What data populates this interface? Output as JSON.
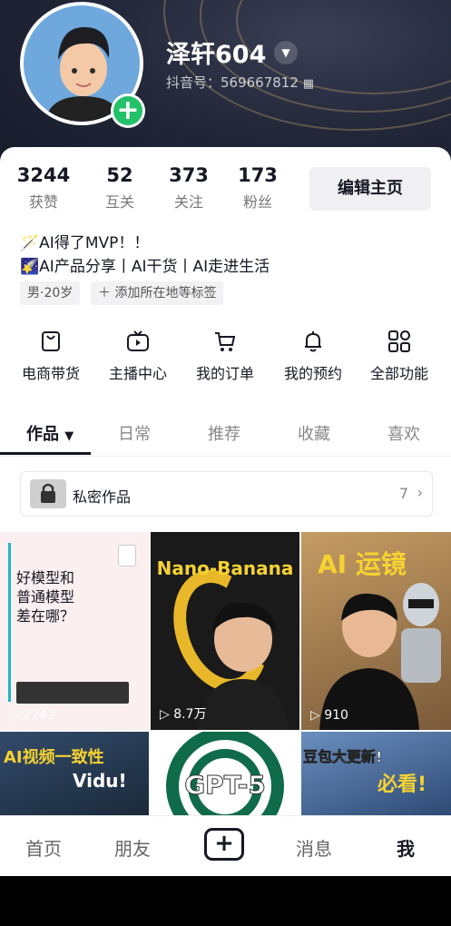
{
  "profile": {
    "username": "泽轩604",
    "douyin_id": "抖音号：569667812",
    "stats": [
      {
        "value": "3244",
        "label": "获赞"
      },
      {
        "value": "52",
        "label": "互关"
      },
      {
        "value": "373",
        "label": "关注"
      },
      {
        "value": "173",
        "label": "粉丝"
      }
    ],
    "edit_label": "编辑主页",
    "bio_line1": "AI得了MVP！！",
    "bio_line2": "AI产品分享丨AI干货丨AI走进生活",
    "tags": [
      "男·20岁",
      "＋ 添加所在地等标签"
    ]
  },
  "functions": [
    {
      "label": "电商带货",
      "icon": "bag-icon"
    },
    {
      "label": "主播中心",
      "icon": "tv-icon"
    },
    {
      "label": "我的订单",
      "icon": "cart-icon"
    },
    {
      "label": "我的预约",
      "icon": "bell-icon"
    },
    {
      "label": "全部功能",
      "icon": "grid-icon"
    }
  ],
  "tabs": [
    "作品",
    "日常",
    "推荐",
    "收藏",
    "喜欢"
  ],
  "private_works": {
    "label": "私密作品",
    "count": "7"
  },
  "videos": [
    {
      "title_lines": [
        "好模型和",
        "普通模型",
        "差在哪？"
      ],
      "plays": "2242"
    },
    {
      "title": "Nano-Banana",
      "plays": "8.7万"
    },
    {
      "title": "AI 运镜",
      "plays": "910"
    },
    {
      "title_lines": [
        "AI视频一致性",
        "Vidu!"
      ]
    },
    {
      "title": "GPT-5"
    },
    {
      "title_lines": [
        "豆包大更新!",
        "必看!"
      ]
    }
  ],
  "bottom_nav": [
    "首页",
    "朋友",
    "消息",
    "我"
  ],
  "colors": {
    "accent_green": "#22c16a",
    "text_dark": "#161823",
    "header_bg": "#1e2333"
  }
}
